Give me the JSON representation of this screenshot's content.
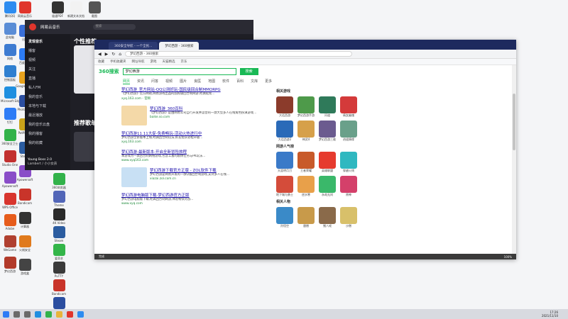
{
  "desktop": {
    "col1": [
      {
        "label": "腾讯QQ",
        "color": "#2d8cf0",
        "icon": "qq-icon"
      },
      {
        "label": "此电脑",
        "color": "#5a8dd6",
        "icon": "computer-icon"
      },
      {
        "label": "网络",
        "color": "#3d7bd1",
        "icon": "network-icon"
      },
      {
        "label": "控制面板",
        "color": "#2f7fd0",
        "icon": "control-panel-icon"
      },
      {
        "label": "Microsoft Edge",
        "color": "#1f8fe0",
        "icon": "edge-icon"
      },
      {
        "label": "钉钉",
        "color": "#2e7cf6",
        "icon": "dingtalk-icon"
      },
      {
        "label": "360安全卫士",
        "color": "#32b24a",
        "icon": "shield-icon"
      },
      {
        "label": "Studio One",
        "color": "#c23030",
        "icon": "studio-icon"
      },
      {
        "label": "Apowersoft",
        "color": "#8a4dc8",
        "icon": "apowersoft-icon"
      },
      {
        "label": "WPS Office",
        "color": "#d8352e",
        "icon": "wps-icon"
      },
      {
        "label": "Adobe",
        "color": "#e65c1c",
        "icon": "adobe-icon"
      },
      {
        "label": "WeGame",
        "color": "#b04030",
        "icon": "wegame-icon"
      },
      {
        "label": "梦幻西游",
        "color": "#b23a2a",
        "icon": "game-icon"
      }
    ],
    "col2": [
      {
        "label": "网易云音乐",
        "color": "#e0352c",
        "icon": "music-icon"
      },
      {
        "label": "迅雷",
        "color": "#3a6fd8",
        "icon": "thunder-icon"
      },
      {
        "label": "百度网盘",
        "color": "#2d7cf5",
        "icon": "cloud-icon"
      },
      {
        "label": "Google Chrome",
        "color": "#e8a31e",
        "icon": "chrome-icon"
      },
      {
        "label": "Photoshop",
        "color": "#2b4ea0",
        "icon": "photoshop-icon"
      },
      {
        "label": "PotPlayer",
        "color": "#c9a31a",
        "icon": "player-icon"
      },
      {
        "label": "Steam",
        "color": "#2b5ca0",
        "icon": "steam-icon"
      },
      {
        "label": "Apowersoft",
        "color": "#8a4dc8",
        "icon": "apowersoft-icon"
      },
      {
        "label": "Bandicam",
        "color": "#c9342a",
        "icon": "bandicam-icon"
      },
      {
        "label": "计算器",
        "color": "#333333",
        "icon": "calc-icon"
      },
      {
        "label": "火绒安全",
        "color": "#e07a1c",
        "icon": "huorong-icon"
      },
      {
        "label": "游戏盒",
        "color": "#444444",
        "icon": "box-icon"
      }
    ],
    "top_row": [
      {
        "label": "极速PDF",
        "color": "#333333",
        "icon": "pdf-icon"
      },
      {
        "label": "新建文本文档",
        "color": "#f2f2f2",
        "icon": "file-icon"
      },
      {
        "label": "截图",
        "color": "#555555",
        "icon": "screenshot-icon"
      }
    ],
    "col3": [
      {
        "label": "360浏览器",
        "color": "#32b24a",
        "icon": "browser-icon"
      },
      {
        "label": "Theme",
        "color": "#5266b8",
        "icon": "theme-icon"
      },
      {
        "label": "4K Video",
        "color": "#2a2a2a",
        "icon": "video-icon"
      },
      {
        "label": "Steam",
        "color": "#2b5ca0",
        "icon": "steam-icon"
      },
      {
        "label": "爱奇艺",
        "color": "#33b549",
        "icon": "iqiyi-icon"
      },
      {
        "label": "PuTTY",
        "color": "#3a3a3a",
        "icon": "putty-icon"
      },
      {
        "label": "Bandicam",
        "color": "#c9342a",
        "icon": "bandicam-icon"
      },
      {
        "label": "Photoshop",
        "color": "#2b4ea0",
        "icon": "photoshop-icon"
      }
    ]
  },
  "music": {
    "app_title": "网易云音乐",
    "search_placeholder": "搜索",
    "sidebar": [
      "发现音乐",
      "播客",
      "视频",
      "关注",
      "直播",
      "私人FM",
      "我的音乐",
      "本地与下载",
      "最近播放",
      "我的音乐云盘",
      "我的播客",
      "我的收藏"
    ],
    "main_heading": "个性推荐",
    "section_heading": "推荐歌单",
    "now_playing": "Young Boss 2.0",
    "now_playing_artist": "Lambert / 小小女孩"
  },
  "browser": {
    "tabs": [
      "360安全导航 - 一个全民...",
      "梦幻西游 - 360搜索"
    ],
    "address": "梦幻西游 - 360搜索",
    "bookmarks": [
      "收藏",
      "手机收藏夹",
      "网址导航",
      "游戏",
      "天猫精选",
      "京东"
    ],
    "search": {
      "logo": "360搜索",
      "query": "梦幻西游",
      "button": "搜索"
    },
    "category_tabs": [
      "网页",
      "资讯",
      "问答",
      "视频",
      "图片",
      "良医",
      "地图",
      "软件",
      "百科",
      "文库",
      "更多"
    ],
    "results": [
      {
        "title": "梦幻西游_官方网站-QQ公测好玩-国民级回合制MMORPG",
        "desc": "《梦幻西游》官方网站,网易游戏出品的国民级回合制网游,经典延续...",
        "url": "xyq.163.com - 官网"
      },
      {
        "title": "梦幻西游_360百科",
        "desc": "《梦幻西游》是由网易公司自行开发并运营的一款大型多人在线角色扮演游戏...",
        "url": "baike.so.com"
      },
      {
        "title": "梦幻西游11.11大促-免费畅玩-活动火热进行中",
        "desc": "梦幻西游全新版本上线,经典回合制玩法,好友组队轻松升级...",
        "url": "xyq.163.com"
      },
      {
        "title": "梦幻西游-最新版本-开启全新冒险旅程",
        "desc": "本游戏为一款回合制网络游戏,包含丰富的剧情任务与PK玩法...",
        "url": "www.xyq163.com"
      },
      {
        "title": "梦幻西游下载官方正版 - ZOL软件下载",
        "desc": "梦幻西游是网易开发的一款Q版回合制游戏,支持多人在线...",
        "url": "xiazai.zol.com.cn"
      },
      {
        "title": "梦幻西游电脑版下载-梦幻西游官方正版",
        "desc": "梦幻西游电脑版下载,经典回合制网游,体验畅快对战...",
        "url": "www.xyq.com"
      }
    ],
    "side_sections": [
      {
        "heading": "相关游戏",
        "items": [
          {
            "name": "大话西游",
            "color": "#8b3b2b"
          },
          {
            "name": "梦幻西游手游",
            "color": "#4e9a4a"
          },
          {
            "name": "问道",
            "color": "#2f7a5a"
          },
          {
            "name": "倩女幽魂",
            "color": "#d43a3a"
          },
          {
            "name": "大话西游2",
            "color": "#2a6ab8"
          },
          {
            "name": "神武4",
            "color": "#d6a04a"
          },
          {
            "name": "梦幻西游三维版",
            "color": "#6b5b8f"
          },
          {
            "name": "逍遥情缘",
            "color": "#6aa08a"
          }
        ]
      },
      {
        "heading": "网游人气榜",
        "items": [
          {
            "name": "天涯明月刀",
            "color": "#3a7ac8"
          },
          {
            "name": "王者荣耀",
            "color": "#c85a2a"
          },
          {
            "name": "英雄联盟",
            "color": "#e63b2e"
          },
          {
            "name": "穿越火线",
            "color": "#2fb8c0"
          },
          {
            "name": "地下城与勇士",
            "color": "#d44c3a"
          },
          {
            "name": "逆水寒",
            "color": "#e8a04a"
          },
          {
            "name": "永劫无间",
            "color": "#3ab86a"
          },
          {
            "name": "原神",
            "color": "#d4406a"
          }
        ]
      },
      {
        "heading": "相关人物",
        "items": [
          {
            "name": "孙悟空",
            "color": "#3a8ac8"
          },
          {
            "name": "唐僧",
            "color": "#c89a4a"
          },
          {
            "name": "猪八戒",
            "color": "#8a6a4a"
          },
          {
            "name": "沙僧",
            "color": "#d8c06a"
          }
        ]
      }
    ],
    "status_text": "完成",
    "status_right": "100%"
  },
  "taskbar": {
    "time": "17:26",
    "date": "2021/11/10",
    "apps": [
      {
        "icon": "windows-icon",
        "color": "#2d7cf5"
      },
      {
        "icon": "search-icon",
        "color": "#6a6a6a"
      },
      {
        "icon": "task-view-icon",
        "color": "#6a6a6a"
      },
      {
        "icon": "edge-icon",
        "color": "#1f8fe0"
      },
      {
        "icon": "browser-icon",
        "color": "#32b24a"
      },
      {
        "icon": "folder-icon",
        "color": "#e8b43a"
      },
      {
        "icon": "music-icon",
        "color": "#e0352c"
      },
      {
        "icon": "qq-icon",
        "color": "#2d8cf0"
      }
    ]
  }
}
